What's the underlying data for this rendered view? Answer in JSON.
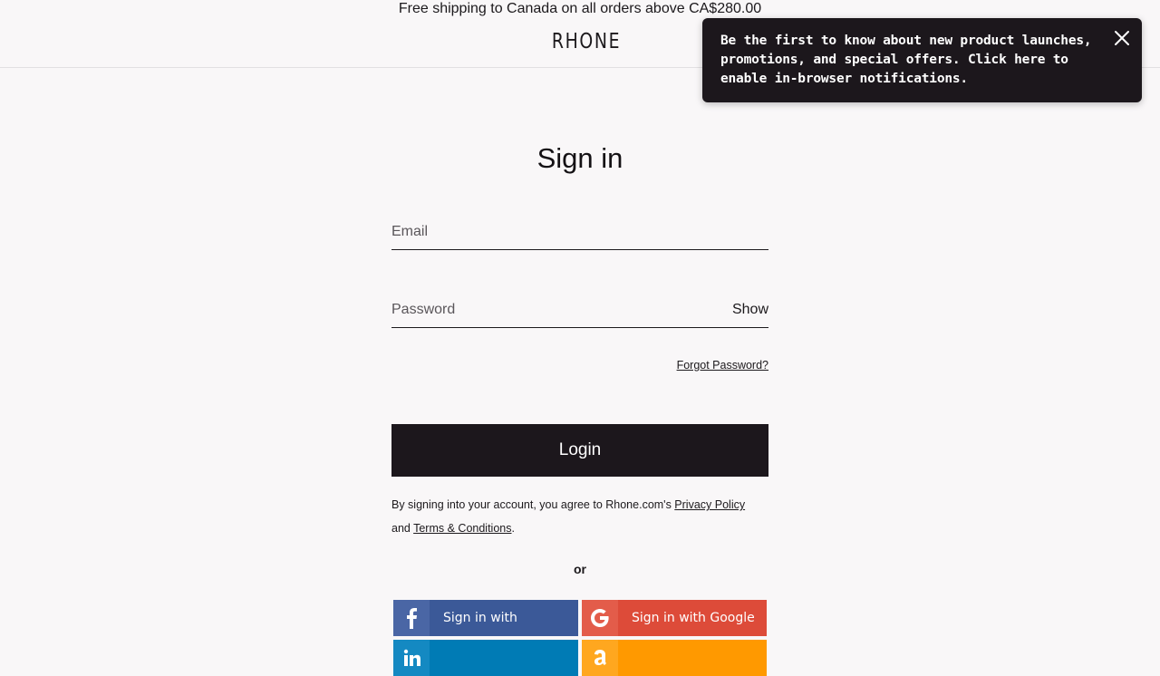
{
  "announcement": "Free shipping to Canada on all orders above CA$280.00",
  "logo": "RHONE",
  "notification_toast": {
    "text": "Be the first to know about new product launches, promotions, and special offers. Click here to enable in-browser notifications.",
    "close_icon": "close-icon"
  },
  "page_title": "Sign in",
  "form": {
    "email_placeholder": "Email",
    "email_value": "",
    "password_placeholder": "Password",
    "password_value": "",
    "show_label": "Show",
    "forgot_label": "Forgot Password?",
    "login_label": "Login"
  },
  "legal": {
    "prefix": "By signing into your account, you agree to Rhone.com's ",
    "privacy_label": "Privacy Policy",
    "and": "and ",
    "terms_label": "Terms & Conditions",
    "suffix": "."
  },
  "or_label": "or",
  "social": {
    "facebook_label": "Sign in with",
    "google_label": "Sign in with Google",
    "linkedin_label": "",
    "amazon_label": "",
    "colors": {
      "facebook": "#3b5998",
      "google": "#dd4b39",
      "linkedin": "#007bb5",
      "amazon": "#ff9900"
    }
  },
  "colors": {
    "background": "#f9f7f8",
    "primary_dark": "#1c171c"
  }
}
